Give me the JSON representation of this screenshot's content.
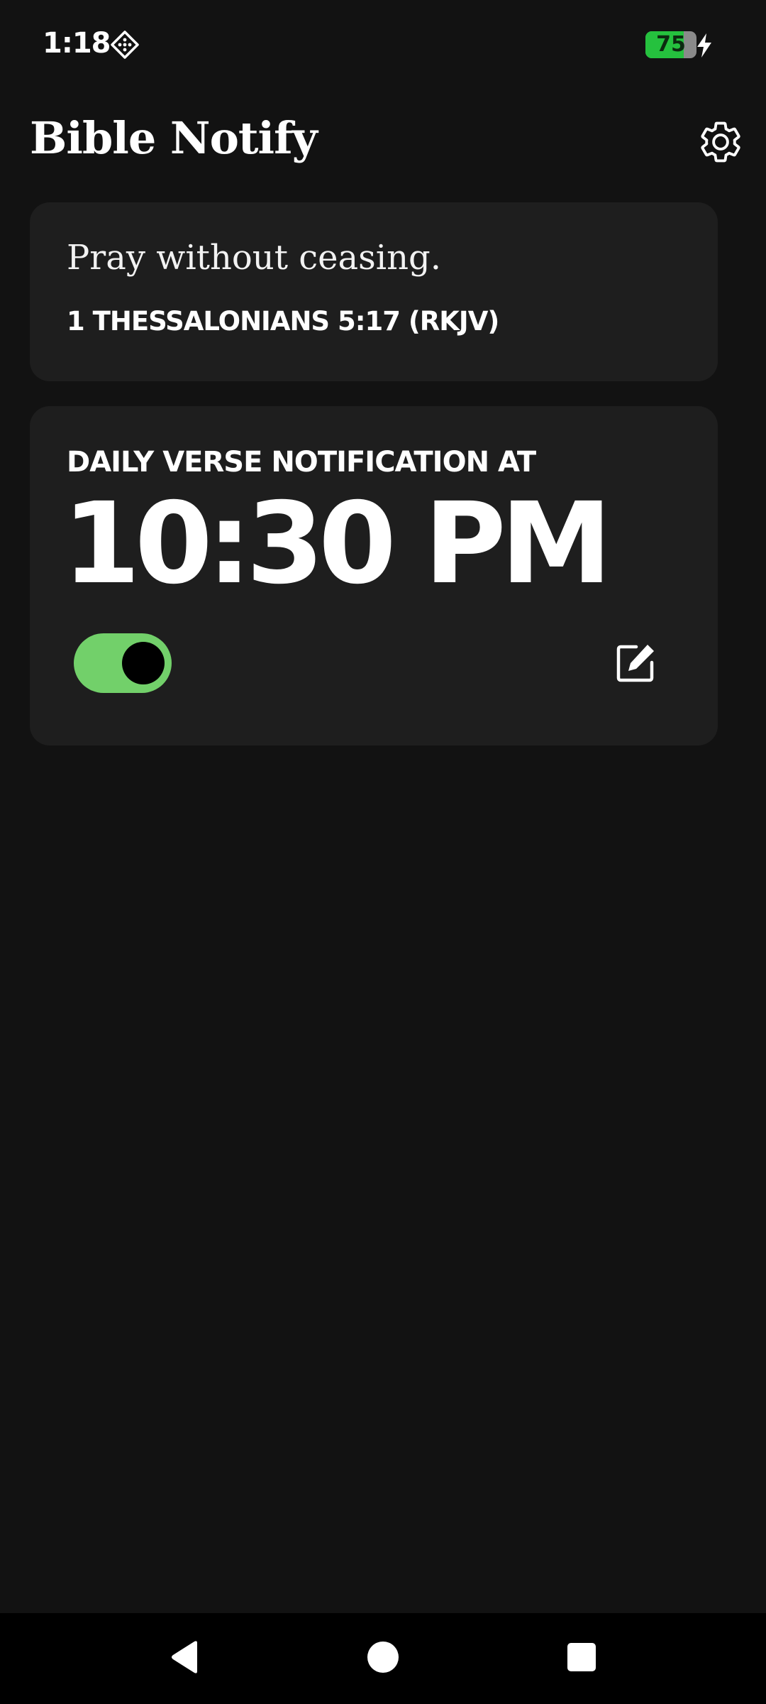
{
  "status_bar": {
    "time": "1:18",
    "app_icon": "notification-app-icon",
    "battery_level": "75",
    "battery_fraction": 0.75,
    "charging": true,
    "battery_color": "#25c13e"
  },
  "header": {
    "title": "Bible Notify",
    "settings_icon": "gear-icon"
  },
  "verse_card": {
    "text": "Pray without ceasing.",
    "reference": "1 THESSALONIANS 5:17 (RKJV)"
  },
  "notification_card": {
    "label": "DAILY VERSE NOTIFICATION AT",
    "time": "10:30 PM",
    "enabled": true,
    "toggle_color": "#72d06a",
    "edit_icon": "edit-icon"
  },
  "nav_bar": {
    "back_icon": "back-triangle-icon",
    "home_icon": "home-circle-icon",
    "recents_icon": "recents-square-icon"
  }
}
